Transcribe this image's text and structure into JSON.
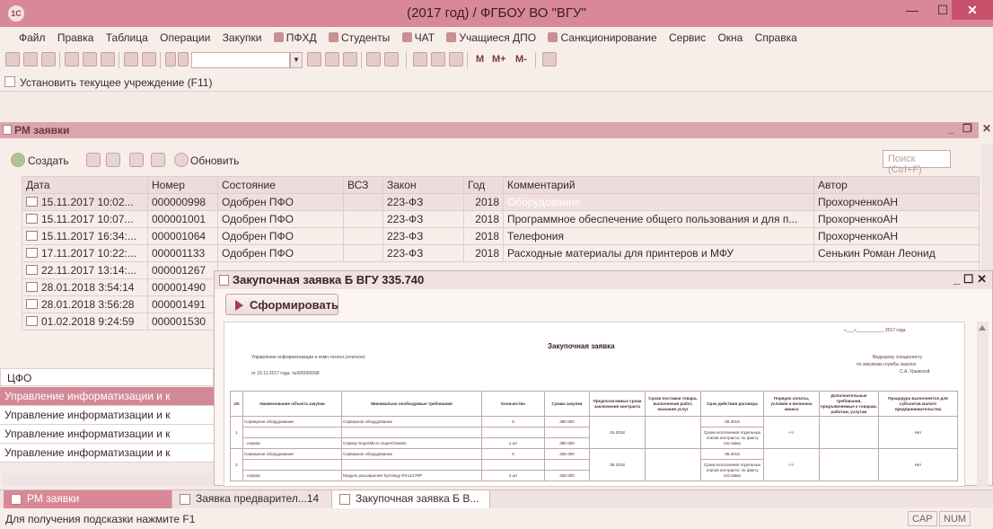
{
  "window": {
    "title": "(2017 год) / ФГБОУ ВО \"ВГУ\"",
    "app_icon": "1С"
  },
  "menu": [
    "Файл",
    "Правка",
    "Таблица",
    "Операции",
    "Закупки",
    "ПФХД",
    "Студенты",
    "ЧАТ",
    "Учащиеся ДПО",
    "Санкционирование",
    "Сервис",
    "Окна",
    "Справка"
  ],
  "toolbar": {
    "m1": "M",
    "m2": "M+",
    "m3": "M-",
    "search_value": ""
  },
  "setup": {
    "label": "Установить текущее учреждение (F11)"
  },
  "rm": {
    "title": "РМ заявки",
    "create": "Создать",
    "refresh": "Обновить",
    "search_placeholder": "Поиск (Ctrl+F)",
    "columns": [
      "Дата",
      "Номер",
      "Состояние",
      "ВСЗ",
      "Закон",
      "Год",
      "Комментарий",
      "Автор"
    ],
    "rows": [
      {
        "date": "15.11.2017 10:02...",
        "num": "000000998",
        "state": "Одобрен ПФО",
        "vsz": "",
        "law": "223-ФЗ",
        "year": "2018",
        "comment": "Оборудование",
        "author": "ПрохорченкоАН"
      },
      {
        "date": "15.11.2017 10:07...",
        "num": "000001001",
        "state": "Одобрен ПФО",
        "vsz": "",
        "law": "223-ФЗ",
        "year": "2018",
        "comment": "Программное обеспечение общего пользования и для п...",
        "author": "ПрохорченкоАН"
      },
      {
        "date": "15.11.2017 16:34:...",
        "num": "000001064",
        "state": "Одобрен ПФО",
        "vsz": "",
        "law": "223-ФЗ",
        "year": "2018",
        "comment": "Телефония",
        "author": "ПрохорченкоАН"
      },
      {
        "date": "17.11.2017 10:22:...",
        "num": "000001133",
        "state": "Одобрен ПФО",
        "vsz": "",
        "law": "223-ФЗ",
        "year": "2018",
        "comment": "Расходные материалы для принтеров и МФУ",
        "author": "Сенькин Роман Леонид"
      },
      {
        "date": "22.11.2017 13:14:...",
        "num": "000001267",
        "state": "",
        "vsz": "",
        "law": "",
        "year": "",
        "comment": "",
        "author": ""
      },
      {
        "date": "28.01.2018 3:54:14",
        "num": "000001490",
        "state": "",
        "vsz": "",
        "law": "",
        "year": "",
        "comment": "",
        "author": ""
      },
      {
        "date": "28.01.2018 3:56:28",
        "num": "000001491",
        "state": "",
        "vsz": "",
        "law": "",
        "year": "",
        "comment": "",
        "author": ""
      },
      {
        "date": "01.02.2018 9:24:59",
        "num": "000001530",
        "state": "",
        "vsz": "",
        "law": "",
        "year": "",
        "comment": "",
        "author": ""
      }
    ],
    "cfo_header": "ЦФО",
    "cfo_rows": [
      "Управление информатизации и к",
      "Управление информатизации и к",
      "Управление информатизации и к",
      "Управление информатизации и к"
    ]
  },
  "zwin": {
    "title": "Закупочная заявка Б ВГУ 335.740",
    "form_button": "Сформировать",
    "doc": {
      "date_line": "«___»___________ 2017 года",
      "title": "Закупочная заявка",
      "dept": "Управление информатизации и комп.технол.(платное)",
      "from": "от 15.11.2017 года. №000000998",
      "addr1": "Ведущему специалисту",
      "addr2": "по закупкам службы закупок",
      "addr3": "С.А. Урывской",
      "head": [
        "з/п",
        "Наименование объекта закупки",
        "Минимально необходимые требования",
        "Количество",
        "Сумма закупки",
        "Предполагаемые сроки заключения контракта",
        "Сроки поставки товара, выполнения работ, оказания услуг",
        "Срок действия договора",
        "Порядок оплаты, условия и величина аванса",
        "Дополнительные требования, предъявляемые к товарам, работам, услугам",
        "Процедура выполняется для субъектов малого предпринимательства"
      ],
      "rows": [
        {
          "n": "",
          "name": "Серверное оборудование",
          "req": "Серверное оборудование",
          "qty": "X",
          "sum": "380 000",
          "p": "",
          "d": "",
          "term": "08.2018",
          "pay": "",
          "add": "",
          "smp": ""
        },
        {
          "n": "1",
          "name": "",
          "req": "",
          "qty": "",
          "sum": "",
          "p": "04.2018",
          "d": "",
          "term": "Сроки исполнения отдельных этапов контракта: по факту поставки",
          "pay": "-/-/-",
          "add": "",
          "smp": "Нет"
        },
        {
          "n": "",
          "name": "- сервер",
          "req": "Сервер SuperMicro SuperChassis",
          "qty": "1 шт",
          "sum": "380 000",
          "p": "",
          "d": "",
          "term": "",
          "pay": "",
          "add": "",
          "smp": ""
        },
        {
          "n": "",
          "name": "Серверное оборудование",
          "req": "Серверное оборудование",
          "qty": "X",
          "sum": "330 000",
          "p": "",
          "d": "",
          "term": "08.2018",
          "pay": "",
          "add": "",
          "smp": ""
        },
        {
          "n": "2",
          "name": "",
          "req": "",
          "qty": "",
          "sum": "",
          "p": "08.2018",
          "d": "",
          "term": "Сроки исполнения отдельных этапов контракта: по факту поставки",
          "pay": "-/-/-",
          "add": "",
          "smp": "Нет"
        },
        {
          "n": "",
          "name": "- сервер",
          "req": "Модуль расширения Synology RX1217RP",
          "qty": "2 шт",
          "sum": "330 000",
          "p": "",
          "d": "",
          "term": "",
          "pay": "",
          "add": "",
          "smp": ""
        }
      ]
    }
  },
  "tabs": [
    "РМ заявки",
    "Заявка предварител...14",
    "Закупочная заявка Б В..."
  ],
  "status": {
    "hint": "Для получения подсказки нажмите F1",
    "cap": "CAP",
    "num": "NUM"
  }
}
